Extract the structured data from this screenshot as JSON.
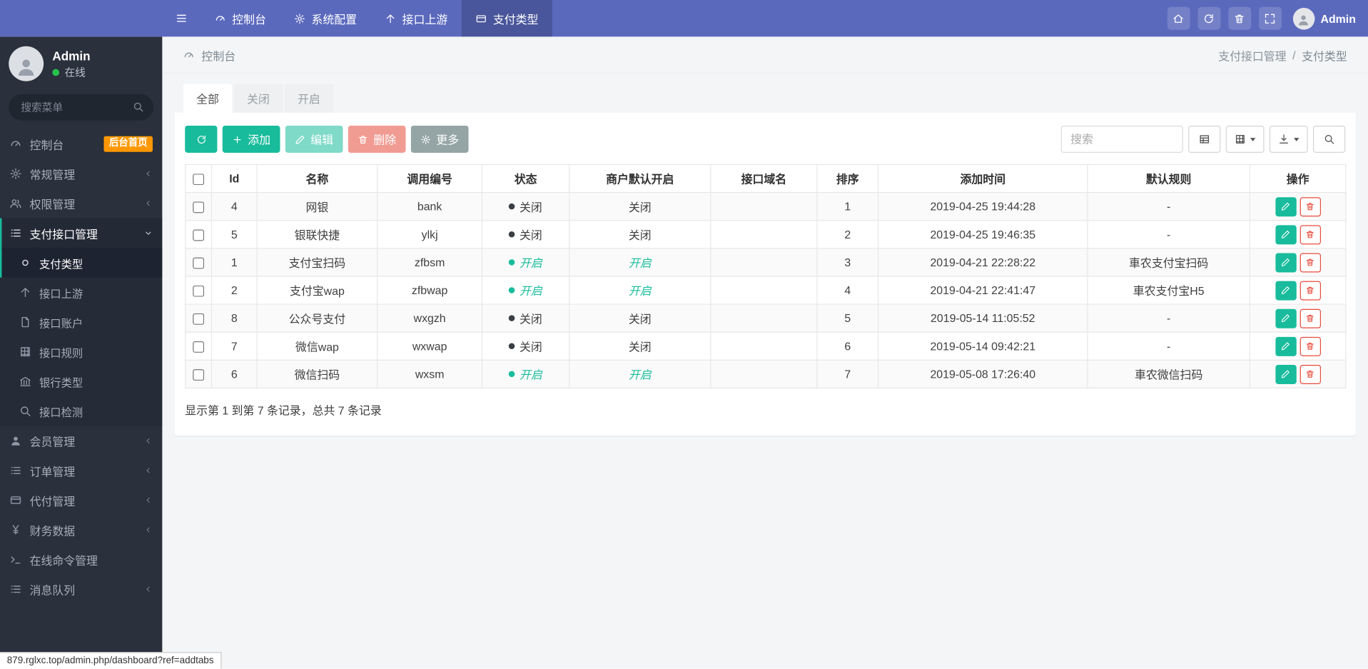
{
  "colors": {
    "navbar": "#5b69bd",
    "accent": "#18bc9c",
    "danger": "#e74c3c",
    "badge": "#ff9800",
    "sidebar": "#2a303c"
  },
  "topnav": {
    "items": [
      {
        "label": "控制台",
        "icon": "gauge-icon"
      },
      {
        "label": "系统配置",
        "icon": "gear-icon"
      },
      {
        "label": "接口上游",
        "icon": "arrow-up-icon"
      },
      {
        "label": "支付类型",
        "icon": "credit-card-icon"
      }
    ],
    "user_name": "Admin"
  },
  "sidebar": {
    "user_name": "Admin",
    "user_status": "在线",
    "search_placeholder": "搜索菜单",
    "menu": [
      {
        "label": "控制台",
        "badge": "后台首页"
      },
      {
        "label": "常规管理"
      },
      {
        "label": "权限管理"
      },
      {
        "label": "支付接口管理"
      },
      {
        "label": "会员管理"
      },
      {
        "label": "订单管理"
      },
      {
        "label": "代付管理"
      },
      {
        "label": "财务数据"
      },
      {
        "label": "在线命令管理"
      },
      {
        "label": "消息队列"
      }
    ],
    "submenu": [
      {
        "label": "支付类型"
      },
      {
        "label": "接口上游"
      },
      {
        "label": "接口账户"
      },
      {
        "label": "接口规则"
      },
      {
        "label": "银行类型"
      },
      {
        "label": "接口检测"
      }
    ]
  },
  "breadcrumb": {
    "left": "控制台",
    "right_section": "支付接口管理",
    "separator": "/",
    "right_page": "支付类型"
  },
  "tabs": [
    "全部",
    "关闭",
    "开启"
  ],
  "toolbar": {
    "add_label": "添加",
    "edit_label": "编辑",
    "delete_label": "删除",
    "more_label": "更多",
    "search_placeholder": "搜索"
  },
  "table": {
    "columns": [
      "Id",
      "名称",
      "调用编号",
      "状态",
      "商户默认开启",
      "接口域名",
      "排序",
      "添加时间",
      "默认规则",
      "操作"
    ],
    "rows": [
      {
        "id": "4",
        "name": "网银",
        "code": "bank",
        "status": "关闭",
        "merchant": "关闭",
        "domain": "",
        "sort": "1",
        "time": "2019-04-25 19:44:28",
        "rule": "-"
      },
      {
        "id": "5",
        "name": "银联快捷",
        "code": "ylkj",
        "status": "关闭",
        "merchant": "关闭",
        "domain": "",
        "sort": "2",
        "time": "2019-04-25 19:46:35",
        "rule": "-"
      },
      {
        "id": "1",
        "name": "支付宝扫码",
        "code": "zfbsm",
        "status": "开启",
        "merchant": "开启",
        "domain": "",
        "sort": "3",
        "time": "2019-04-21 22:28:22",
        "rule": "車农支付宝扫码"
      },
      {
        "id": "2",
        "name": "支付宝wap",
        "code": "zfbwap",
        "status": "开启",
        "merchant": "开启",
        "domain": "",
        "sort": "4",
        "time": "2019-04-21 22:41:47",
        "rule": "車农支付宝H5"
      },
      {
        "id": "8",
        "name": "公众号支付",
        "code": "wxgzh",
        "status": "关闭",
        "merchant": "关闭",
        "domain": "",
        "sort": "5",
        "time": "2019-05-14 11:05:52",
        "rule": "-"
      },
      {
        "id": "7",
        "name": "微信wap",
        "code": "wxwap",
        "status": "关闭",
        "merchant": "关闭",
        "domain": "",
        "sort": "6",
        "time": "2019-05-14 09:42:21",
        "rule": "-"
      },
      {
        "id": "6",
        "name": "微信扫码",
        "code": "wxsm",
        "status": "开启",
        "merchant": "开启",
        "domain": "",
        "sort": "7",
        "time": "2019-05-08 17:26:40",
        "rule": "車农微信扫码"
      }
    ]
  },
  "footer": {
    "summary": "显示第 1 到第 7 条记录，总共 7 条记录"
  },
  "statusbar": {
    "url": "879.rglxc.top/admin.php/dashboard?ref=addtabs"
  }
}
